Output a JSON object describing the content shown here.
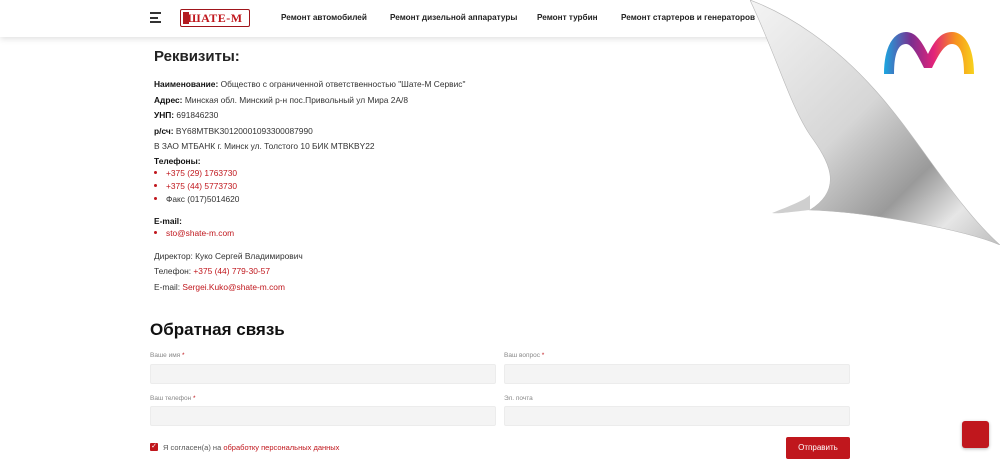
{
  "header": {
    "logo_text": "ШАТЕ-М",
    "nav": [
      {
        "label": "Ремонт автомобилей"
      },
      {
        "label": "Ремонт дизельной аппаратуры"
      },
      {
        "label": "Ремонт турбин"
      },
      {
        "label": "Ремонт стартеров и генераторов"
      }
    ]
  },
  "requisites": {
    "title": "Реквизиты:",
    "name_label": "Наименование:",
    "name_value": "Общество с ограниченной ответственностью \"Шате-М Сервис\"",
    "address_label": "Адрес:",
    "address_value": "Минская обл. Минский р-н пос.Привольный ул Мира 2А/8",
    "unp_label": "УНП:",
    "unp_value": "691846230",
    "account_label": "р/сч:",
    "account_value": "BY68MTBK30120001093300087990",
    "bank": "В ЗАО МТБАНК г. Минск ул. Толстого 10 БИК MTBKBY22",
    "phones_label": "Телефоны:",
    "phones": [
      "+375 (29) 1763730",
      "+375 (44) 5773730",
      "Факс (017)5014620"
    ],
    "email_label": "E-mail:",
    "email": "sto@shate-m.com",
    "director": "Директор: Куко Сергей Владимирович",
    "director_phone_label": "Телефон: ",
    "director_phone": "+375 (44) 779-30-57",
    "director_email_label": "E-mail: ",
    "director_email": "Sergei.Kuko@shate-m.com"
  },
  "feedback": {
    "title": "Обратная связь",
    "name_label": "Ваше имя",
    "question_label": "Ваш вопрос",
    "phone_label": "Ваш телефон",
    "email_label": "Эл. почта",
    "required_mark": "*",
    "agree_prefix": "Я согласен(а) на ",
    "agree_link": "обработку персональных данных",
    "submit_label": "Отправить"
  },
  "colors": {
    "accent": "#c0171d"
  },
  "icons": {
    "menu": "hamburger-icon",
    "checkbox": "check-icon",
    "scroll": "scroll-top-icon",
    "brand": "m-logo-icon"
  }
}
